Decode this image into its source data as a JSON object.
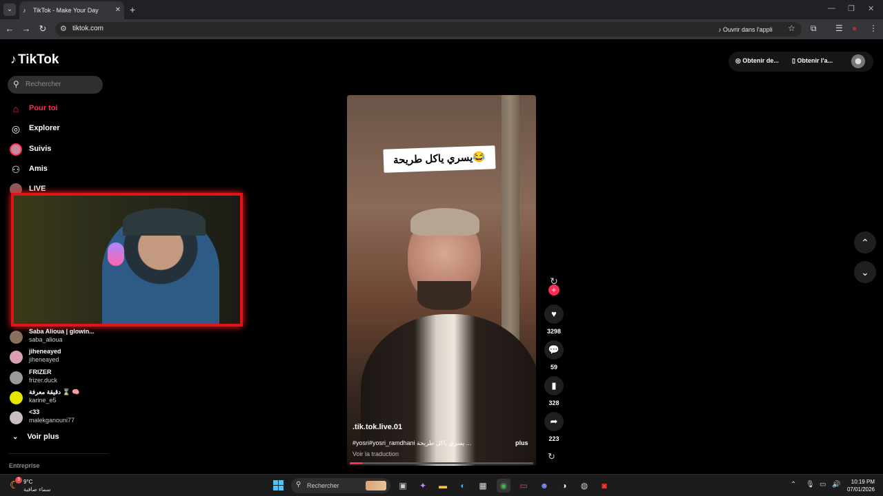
{
  "browser": {
    "tab_title": "TikTok - Make Your Day",
    "url": "tiktok.com",
    "open_in_app": "Ouvrir dans l'appli"
  },
  "sidebar": {
    "logo_text": "TikTok",
    "search_placeholder": "Rechercher",
    "nav": [
      {
        "label": "Pour toi",
        "icon": "home-icon",
        "active": true
      },
      {
        "label": "Explorer",
        "icon": "compass-icon",
        "active": false
      },
      {
        "label": "Suivis",
        "icon": "following-avatar",
        "active": false
      },
      {
        "label": "Amis",
        "icon": "friends-icon",
        "active": false
      },
      {
        "label": "LIVE",
        "icon": "live-avatar",
        "active": false
      }
    ],
    "following_accounts": [
      {
        "name": "Saba Alioua | glowin...",
        "handle": "saba_alioua",
        "avatar_color": "#8a6e60"
      },
      {
        "name": "jiheneayed",
        "handle": "jiheneayed",
        "avatar_color": "#d8a0b0"
      },
      {
        "name": "FRIZER",
        "handle": "frizer.duck",
        "avatar_color": "#9a9a9a"
      },
      {
        "name": "دقيقة معرفة ⌛ 🧠",
        "handle": "karine_e5",
        "avatar_color": "#e6e600"
      },
      {
        "name": "<33",
        "handle": "malekganouni77",
        "avatar_color": "#c8c0c0"
      }
    ],
    "see_more": "Voir plus",
    "footer_label": "Entreprise"
  },
  "top_right": {
    "coins_label": "Obtenir de...",
    "app_label": "Obtenir l'a..."
  },
  "video": {
    "sticker_text": "يسري  ياكل  طريحة😂",
    "author": ".tik.tok.live.01",
    "description": "#yosri#yosri_ramdhani يسري ياكل طريحة ...",
    "more": "plus",
    "translate": "Voir la traduction",
    "progress_percent": 7
  },
  "actions": {
    "likes": "3298",
    "comments": "59",
    "saves": "328",
    "shares": "223"
  },
  "taskbar": {
    "temperature": "9°C",
    "weather_desc": "سماء صافية",
    "weather_badge": "3",
    "search_placeholder": "Rechercher",
    "time": "10:19 PM",
    "date": "07/01/2026"
  },
  "colors": {
    "accent": "#fe2c55",
    "webcam_border": "#e1141b",
    "windows_blue": "#4cc2ff"
  }
}
